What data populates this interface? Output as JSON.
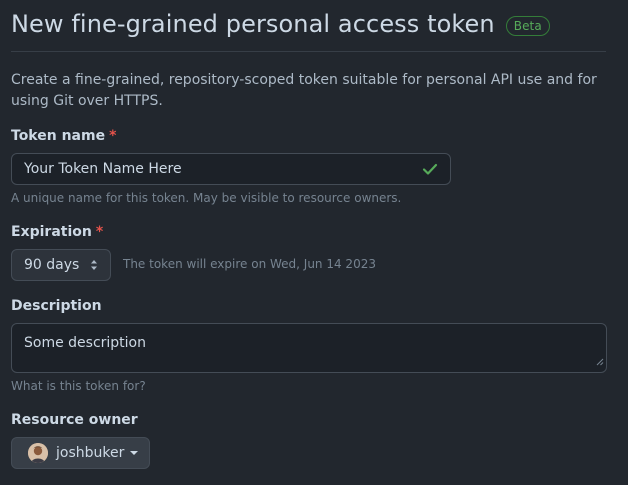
{
  "header": {
    "title": "New fine-grained personal access token",
    "badge": "Beta"
  },
  "intro": "Create a fine-grained, repository-scoped token suitable for personal API use and for using Git over HTTPS.",
  "token_name": {
    "label": "Token name",
    "required_marker": "*",
    "value": "Your Token Name Here",
    "hint": "A unique name for this token. May be visible to resource owners."
  },
  "expiration": {
    "label": "Expiration",
    "required_marker": "*",
    "selected": "90 days",
    "expiry_note": "The token will expire on Wed, Jun 14 2023"
  },
  "description": {
    "label": "Description",
    "value": "Some description",
    "hint": "What is this token for?"
  },
  "resource_owner": {
    "label": "Resource owner",
    "value": "joshbuker"
  },
  "icons": [
    "check-icon",
    "select-arrows-icon",
    "resize-grip-icon",
    "avatar",
    "caret-down-icon"
  ],
  "colors": {
    "background": "#22272e",
    "input_background": "#1c2128",
    "border": "#444c56",
    "required": "#e5534b",
    "success": "#57ab5a",
    "muted_text": "#768390"
  }
}
